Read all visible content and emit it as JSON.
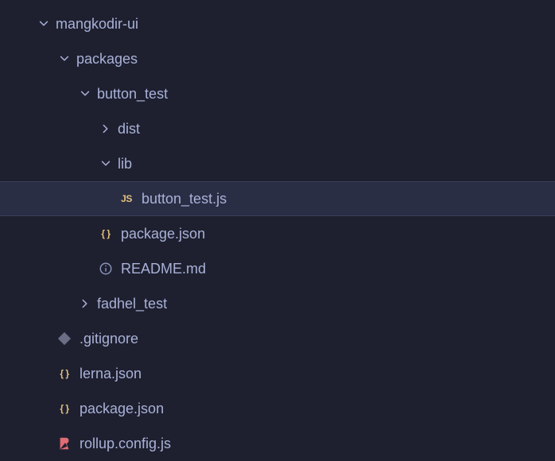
{
  "tree": {
    "root": {
      "name": "mangkodir-ui",
      "expanded": true
    },
    "packages": {
      "name": "packages",
      "expanded": true
    },
    "button_test": {
      "name": "button_test",
      "expanded": true
    },
    "dist": {
      "name": "dist",
      "expanded": false
    },
    "lib": {
      "name": "lib",
      "expanded": true
    },
    "button_test_js": {
      "name": "button_test.js",
      "icon": "js",
      "selected": true
    },
    "pkg_button_package_json": {
      "name": "package.json",
      "icon": "json"
    },
    "readme": {
      "name": "README.md",
      "icon": "info"
    },
    "fadhel_test": {
      "name": "fadhel_test",
      "expanded": false
    },
    "gitignore": {
      "name": ".gitignore",
      "icon": "git"
    },
    "lerna_json": {
      "name": "lerna.json",
      "icon": "json"
    },
    "root_package_json": {
      "name": "package.json",
      "icon": "json"
    },
    "rollup_config": {
      "name": "rollup.config.js",
      "icon": "rollup"
    }
  }
}
